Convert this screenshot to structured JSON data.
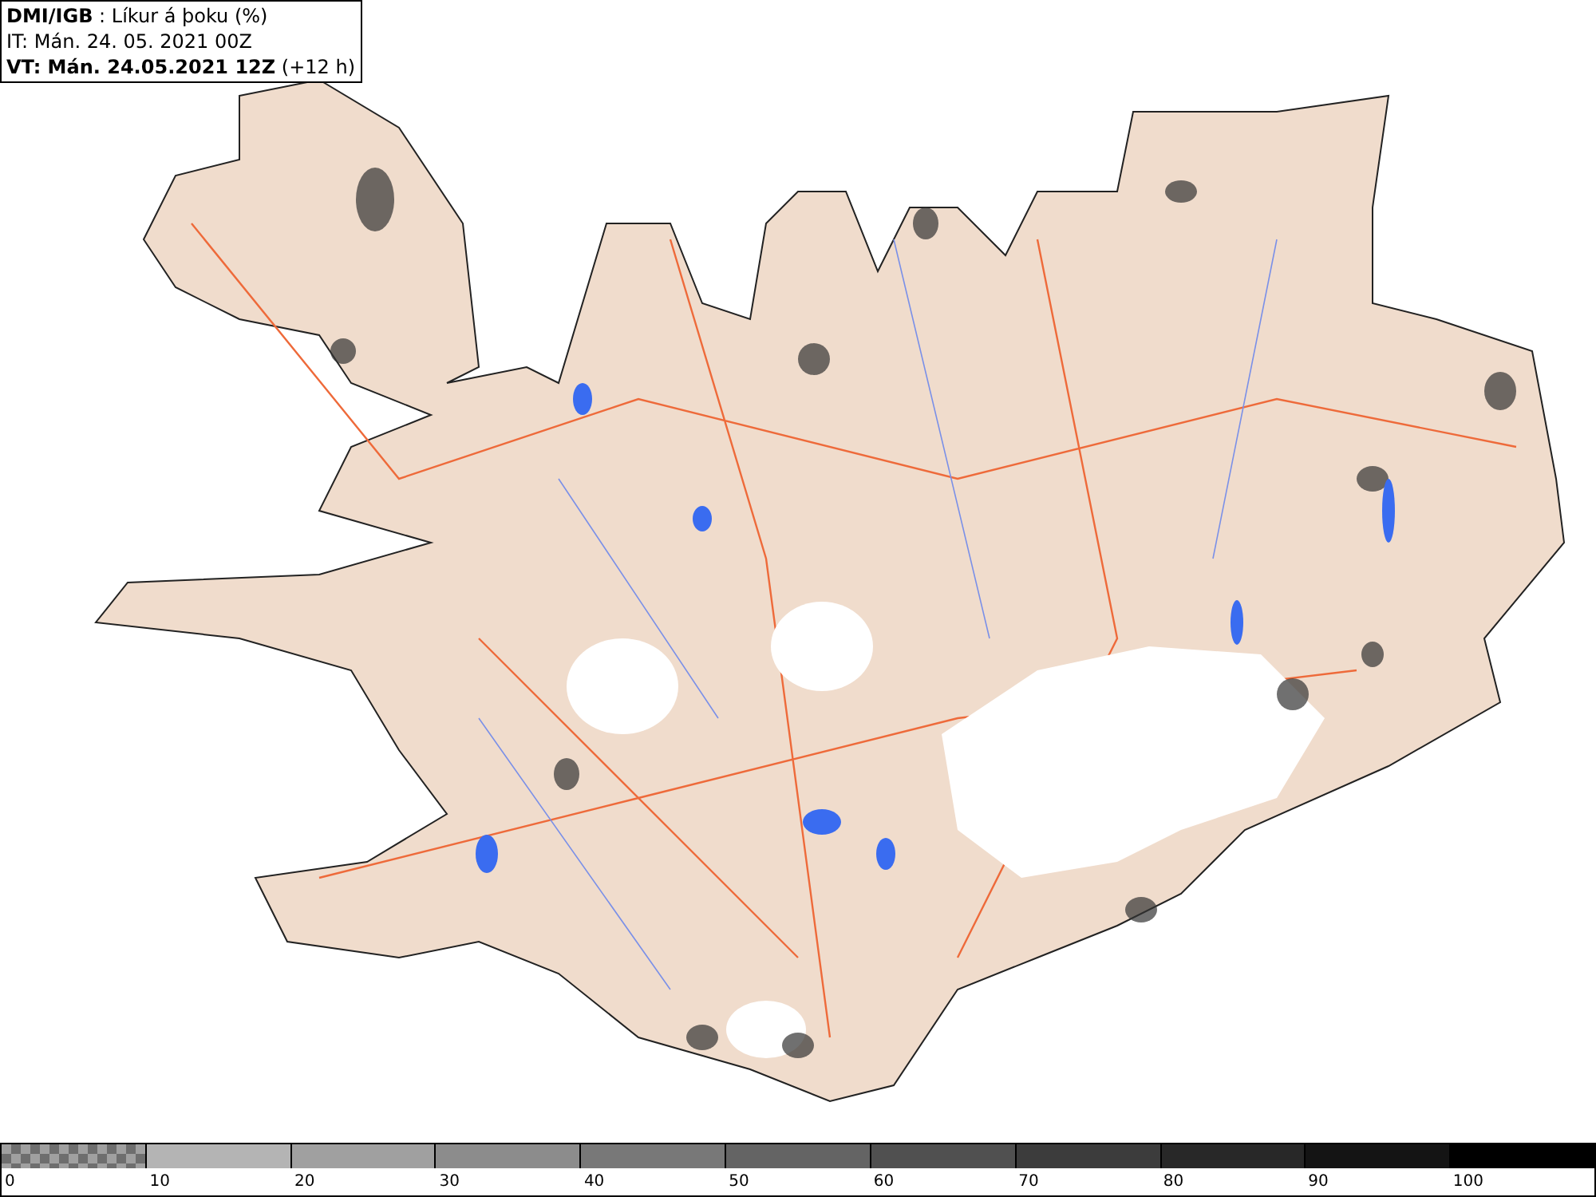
{
  "legend": {
    "lines": [
      "**DMI/IGB** : Líkur á þoku (%)",
      "IT: Mán. 24. 05. 2021 00Z",
      "**VT: Mán. 24.05.2021 12Z** (+12 h)"
    ]
  },
  "colorbar": {
    "segments": [
      {
        "kind": "checker",
        "color": "#a0a0a0"
      },
      {
        "kind": "solid",
        "color": "#b4b4b4"
      },
      {
        "kind": "solid",
        "color": "#a0a0a0"
      },
      {
        "kind": "solid",
        "color": "#8c8c8c"
      },
      {
        "kind": "solid",
        "color": "#787878"
      },
      {
        "kind": "solid",
        "color": "#646464"
      },
      {
        "kind": "solid",
        "color": "#505050"
      },
      {
        "kind": "solid",
        "color": "#3c3c3c"
      },
      {
        "kind": "solid",
        "color": "#282828"
      },
      {
        "kind": "solid",
        "color": "#141414"
      },
      {
        "kind": "solid",
        "color": "#000000"
      }
    ],
    "labels": [
      "0",
      "10",
      "20",
      "30",
      "40",
      "50",
      "60",
      "70",
      "80",
      "90",
      "100"
    ]
  }
}
